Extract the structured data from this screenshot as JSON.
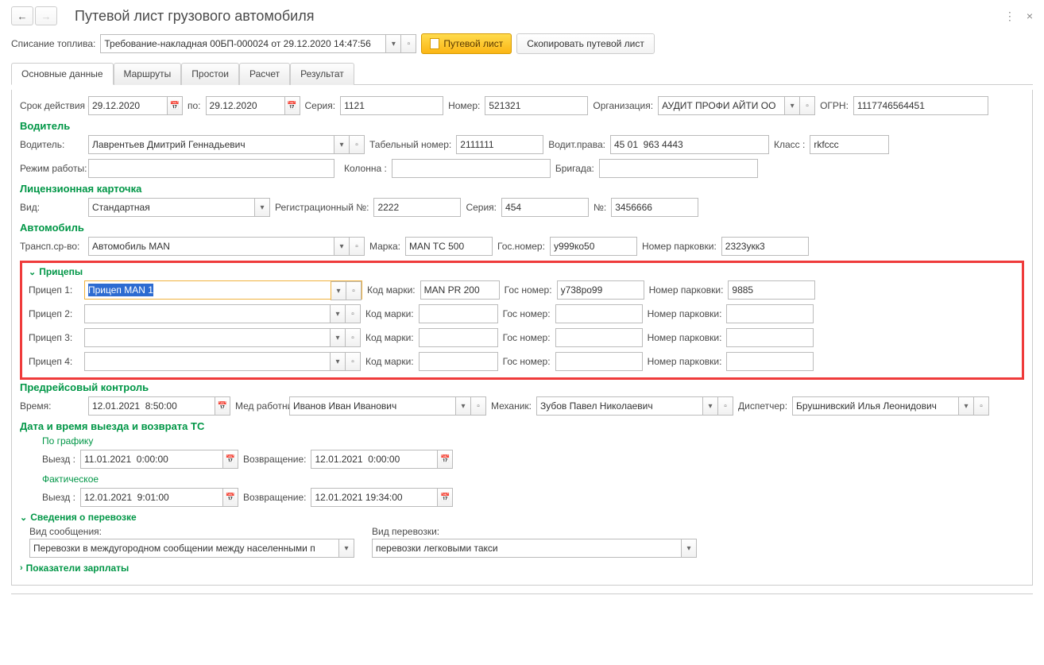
{
  "header": {
    "title": "Путевой лист грузового автомобиля"
  },
  "toolbar": {
    "fuel_writeoff_label": "Списание топлива:",
    "fuel_writeoff_value": "Требование-накладная 00БП-000024 от 29.12.2020 14:47:56",
    "waybill_btn": "Путевой лист",
    "copy_btn": "Скопировать путевой лист"
  },
  "tabs": [
    "Основные данные",
    "Маршруты",
    "Простои",
    "Расчет",
    "Результат"
  ],
  "main": {
    "validity_label": "Срок действия с:",
    "date_from": "29.12.2020",
    "to_label": "по:",
    "date_to": "29.12.2020",
    "series_label": "Серия:",
    "series": "1121",
    "number_label": "Номер:",
    "number": "521321",
    "org_label": "Организация:",
    "org": "АУДИТ ПРОФИ АЙТИ ОО",
    "ogrn_label": "ОГРН:",
    "ogrn": "1117746564451"
  },
  "driver_section": {
    "title": "Водитель",
    "driver_label": "Водитель:",
    "driver": "Лаврентьев Дмитрий Геннадьевич",
    "tab_num_label": "Табельный номер:",
    "tab_num": "2111111",
    "license_label": "Водит.права:",
    "license": "45 01  963 4443",
    "class_label": "Класс      :",
    "class": "rkfccc",
    "work_mode_label": "Режим работы:",
    "column_label": "Колонна     :",
    "brigade_label": "Бригада:"
  },
  "license_card": {
    "title": "Лицензионная карточка",
    "type_label": "Вид:",
    "type": "Стандартная",
    "reg_num_label": "Регистрационный №:",
    "reg_num": "2222",
    "series_label": "Серия:",
    "series": "454",
    "num_label": "№:",
    "num": "3456666"
  },
  "vehicle": {
    "title": "Автомобиль",
    "trans_label": "Трансп.ср-во:",
    "trans": "Автомобиль MAN",
    "brand_label": "Марка:",
    "brand": "MAN TC 500",
    "plate_label": "Гос.номер:",
    "plate": "у999ко50",
    "parking_label": "Номер парковки:",
    "parking": "2323укк3"
  },
  "trailers": {
    "title": "Прицепы",
    "code_label": "Код марки:",
    "plate_label": "Гос номер:",
    "parking_label": "Номер парковки:",
    "rows": [
      {
        "label": "Прицеп 1:",
        "name": "Прицеп MAN 1",
        "code": "MAN PR 200",
        "plate": "у738ро99",
        "parking": "9885"
      },
      {
        "label": "Прицеп 2:",
        "name": "",
        "code": "",
        "plate": "",
        "parking": ""
      },
      {
        "label": "Прицеп 3:",
        "name": "",
        "code": "",
        "plate": "",
        "parking": ""
      },
      {
        "label": "Прицеп 4:",
        "name": "",
        "code": "",
        "plate": "",
        "parking": ""
      }
    ]
  },
  "pretrip": {
    "title": "Предрейсовый контроль",
    "time_label": "Время:",
    "time": "12.01.2021  8:50:00",
    "med_label": "Мед работник:",
    "med": "Иванов Иван Иванович",
    "mech_label": "Механик:",
    "mech": "Зубов Павел Николаевич",
    "disp_label": "Диспетчер:",
    "disp": "Брушнивский Илья Леонидович"
  },
  "departure": {
    "title": "Дата и время выезда и возврата ТС",
    "scheduled": "По графику",
    "actual": "Фактическое",
    "depart_label": "Выезд   :",
    "return_label": "Возвращение:",
    "sched_depart": "11.01.2021  0:00:00",
    "sched_return": "12.01.2021  0:00:00",
    "act_depart": "12.01.2021  9:01:00",
    "act_return": "12.01.2021 19:34:00"
  },
  "transport_info": {
    "title": "Сведения о перевозке",
    "msg_type_label": "Вид сообщения:",
    "msg_type": "Перевозки в междугородном сообщении между населенными п",
    "trans_type_label": "Вид перевозки:",
    "trans_type": "перевозки легковыми такси"
  },
  "salary": {
    "title": "Показатели зарплаты"
  }
}
